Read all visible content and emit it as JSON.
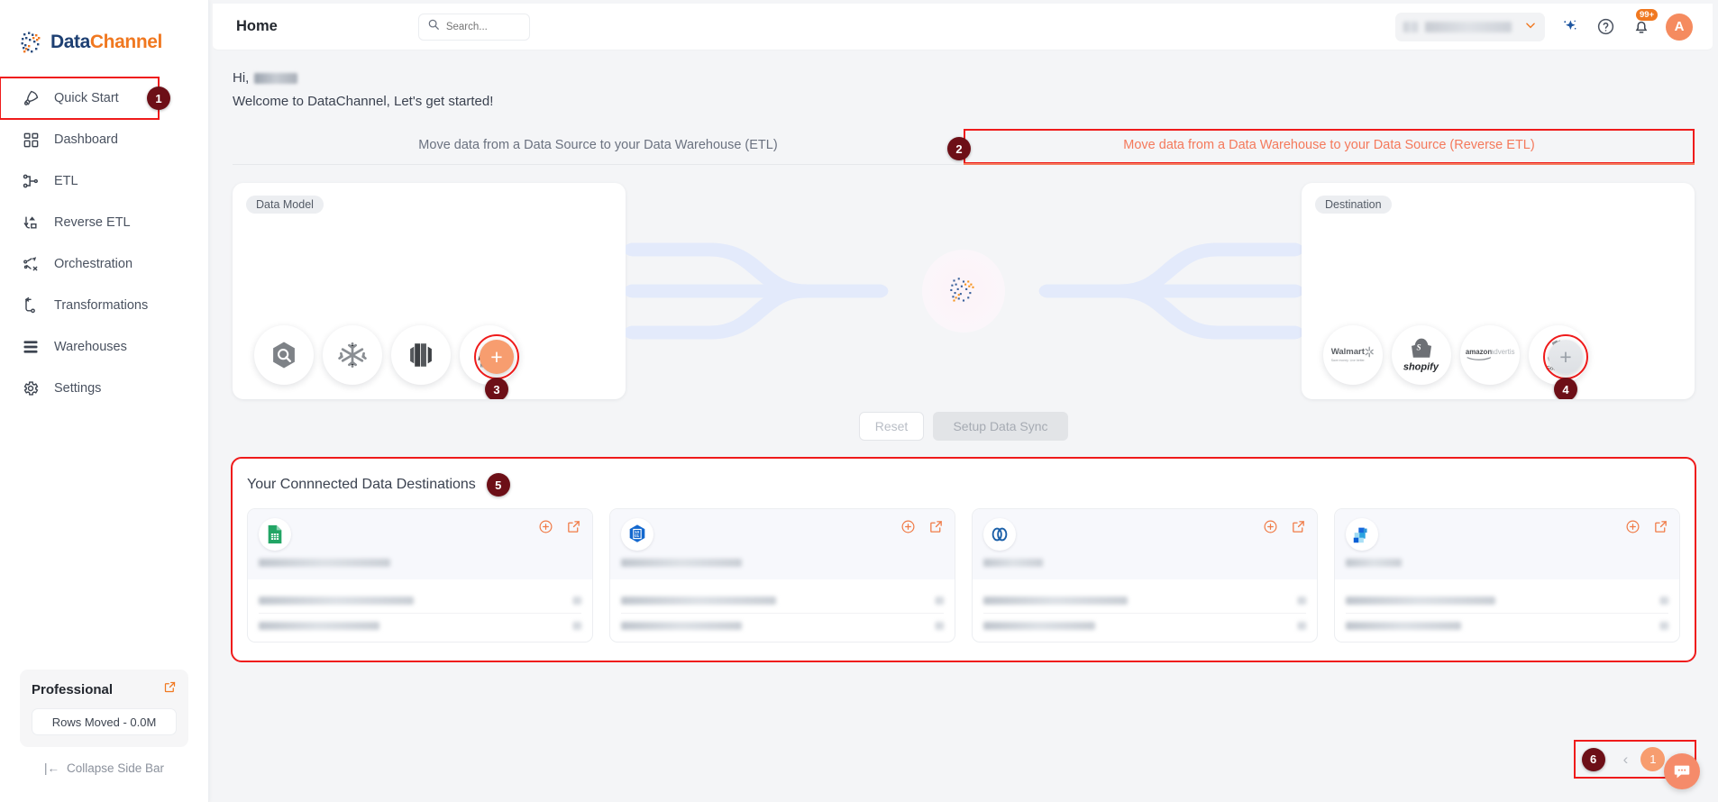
{
  "brand": {
    "name_a": "Data",
    "name_b": "Channel"
  },
  "sidebar": {
    "items": [
      {
        "label": "Quick Start",
        "icon": "rocket-icon"
      },
      {
        "label": "Dashboard",
        "icon": "grid-icon"
      },
      {
        "label": "ETL",
        "icon": "etl-icon"
      },
      {
        "label": "Reverse ETL",
        "icon": "reverse-etl-icon"
      },
      {
        "label": "Orchestration",
        "icon": "orchestration-icon"
      },
      {
        "label": "Transformations",
        "icon": "transformations-icon"
      },
      {
        "label": "Warehouses",
        "icon": "warehouses-icon"
      },
      {
        "label": "Settings",
        "icon": "gear-icon"
      }
    ],
    "plan": {
      "name": "Professional",
      "usage": "Rows Moved - 0.0M",
      "external_icon": "external-link-icon"
    },
    "collapse_label": "Collapse Side Bar"
  },
  "header": {
    "title": "Home",
    "search_placeholder": "Search...",
    "search_value": "",
    "org_selected": "",
    "notifications_count": "99+",
    "avatar_initial": "A",
    "icons": [
      "sparkle-icon",
      "help-icon",
      "bell-icon"
    ]
  },
  "greeting": {
    "hi": "Hi,",
    "welcome": "Welcome to DataChannel, Let's get started!"
  },
  "tabs": [
    {
      "label": "Move data from a Data Source to your Data Warehouse (ETL)",
      "active": false
    },
    {
      "label": "Move data from a Data Warehouse to your Data Source (Reverse ETL)",
      "active": true
    }
  ],
  "flow": {
    "left_tag": "Data Model",
    "right_tag": "Destination",
    "left_logos": [
      "bigquery-icon",
      "snowflake-icon",
      "redshift-icon",
      "mysql-icon"
    ],
    "right_logos": [
      "walmart-icon",
      "shopify-icon",
      "amazon-advertising-icon",
      "google-ads-icon"
    ],
    "left_add_label": "+",
    "right_add_label": "+",
    "reset_label": "Reset",
    "sync_label": "Setup Data Sync"
  },
  "destinations": {
    "title": "Your Connnected Data Destinations",
    "cards": [
      {
        "icon": "google-sheets-icon",
        "name": "",
        "rows": [
          "",
          ""
        ]
      },
      {
        "icon": "binary-file-icon",
        "name": "",
        "rows": [
          "",
          ""
        ]
      },
      {
        "icon": "link-chain-icon",
        "name": "",
        "rows": [
          "",
          ""
        ]
      },
      {
        "icon": "tiles-icon",
        "name": "",
        "rows": [
          "",
          ""
        ]
      }
    ],
    "card_actions": [
      "add-circle-icon",
      "external-link-icon"
    ]
  },
  "pagination": {
    "prev": "‹",
    "next": "›",
    "current_page": "1"
  },
  "annotations": [
    {
      "number": "1",
      "target": "sidebar-quick-start"
    },
    {
      "number": "2",
      "target": "reverse-etl-tab"
    },
    {
      "number": "3",
      "target": "data-model-add"
    },
    {
      "number": "4",
      "target": "destination-add"
    },
    {
      "number": "5",
      "target": "connected-destinations"
    },
    {
      "number": "6",
      "target": "pagination"
    }
  ],
  "colors": {
    "accent": "#f07820",
    "annotation": "#6d0f17",
    "highlight": "#ef1b1b",
    "tab_active": "#f4795b"
  }
}
